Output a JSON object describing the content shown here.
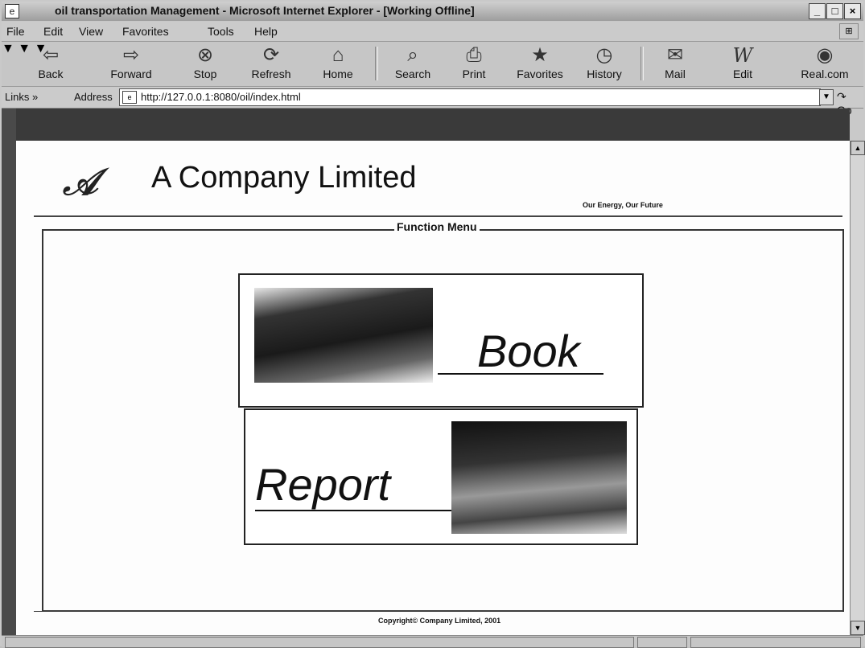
{
  "window": {
    "title": "oil transportation Management - Microsoft Internet Explorer - [Working Offline]"
  },
  "menu": [
    "File",
    "Edit",
    "View",
    "Favorites",
    "Tools",
    "Help"
  ],
  "toolbar": [
    {
      "label": "Back",
      "icon": "back-arrow-icon"
    },
    {
      "label": "Forward",
      "icon": "forward-arrow-icon"
    },
    {
      "label": "Stop",
      "icon": "stop-icon"
    },
    {
      "label": "Refresh",
      "icon": "refresh-icon"
    },
    {
      "label": "Home",
      "icon": "home-icon"
    },
    {
      "label": "Search",
      "icon": "search-icon"
    },
    {
      "label": "Print",
      "icon": "print-icon"
    },
    {
      "label": "Favorites",
      "icon": "favorites-icon"
    },
    {
      "label": "History",
      "icon": "history-icon"
    },
    {
      "label": "Mail",
      "icon": "mail-icon"
    },
    {
      "label": "Edit",
      "icon": "edit-icon"
    },
    {
      "label": "Real.com",
      "icon": "realcom-icon"
    }
  ],
  "addressbar": {
    "links_label": "Links »",
    "address_label": "Address",
    "url": "http://127.0.0.1:8080/oil/index.html",
    "go_label": "Go"
  },
  "page": {
    "company_name": "A Company Limited",
    "slogan": "Our Energy, Our Future",
    "menu_title": "Function Menu",
    "book_label": "Book",
    "report_label": "Report",
    "copyright": "Copyright© Company Limited, 2001"
  }
}
